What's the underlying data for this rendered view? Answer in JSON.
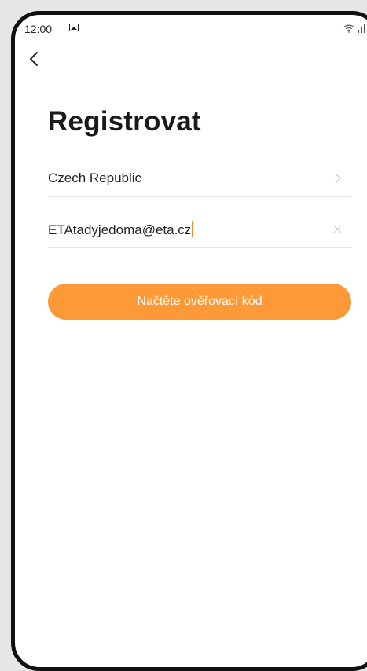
{
  "status_bar": {
    "time": "12:00"
  },
  "header": {
    "title": "Registrovat"
  },
  "form": {
    "country": "Czech Republic",
    "email": "ETAtadyjedoma@eta.cz"
  },
  "submit": {
    "label": "Načtěte ověřovací kód"
  },
  "colors": {
    "accent": "#fd9a37",
    "caret": "#f0892a",
    "text": "#222222",
    "divider": "#e5e5e5"
  },
  "icons": {
    "back": "chevron-left-icon",
    "country_open": "chevron-right-icon",
    "clear": "close-icon",
    "gallery": "image-icon",
    "wifi": "wifi-icon",
    "signal": "signal-icon",
    "battery": "battery-icon"
  }
}
